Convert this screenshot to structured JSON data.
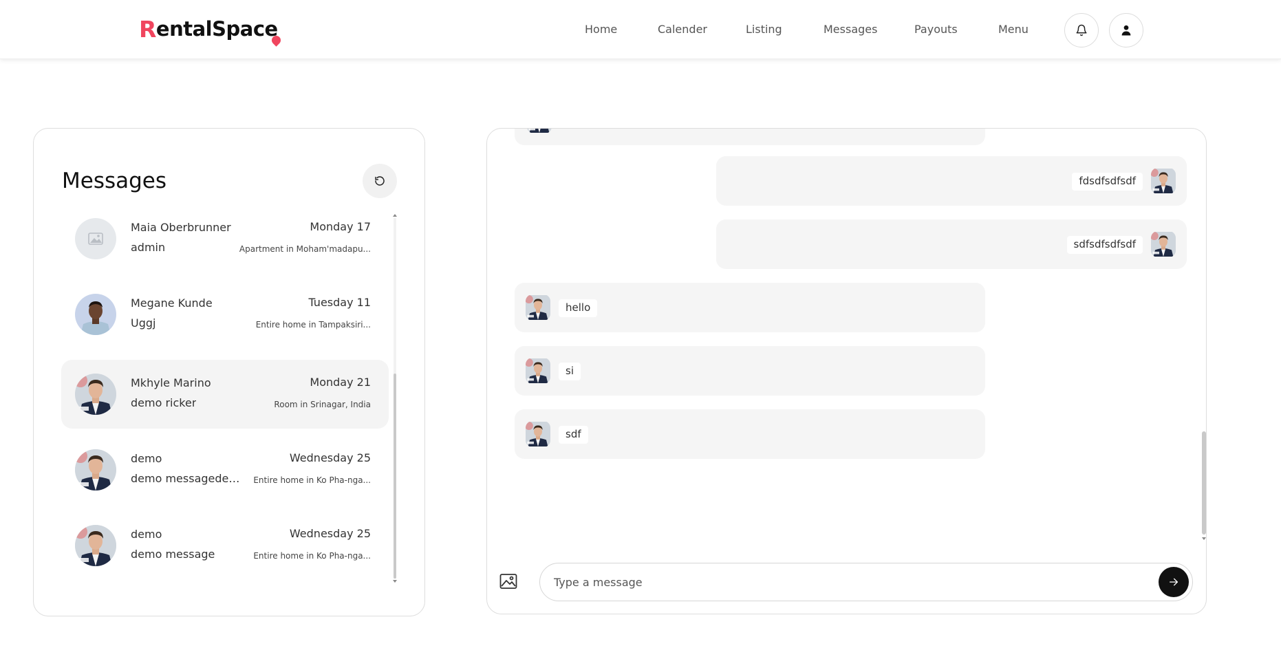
{
  "header": {
    "logo_r": "R",
    "logo_rest": "entalSpace",
    "nav": [
      "Home",
      "Calender",
      "Listing",
      "Messages",
      "Payouts",
      "Menu"
    ],
    "notification_icon": "bell-icon",
    "profile_icon": "user-icon"
  },
  "sidebar": {
    "title": "Messages",
    "refresh_icon": "refresh-icon",
    "conversations": [
      {
        "name": "Maia Oberbrunner",
        "preview": "admin",
        "date": "Monday 17",
        "listing": "Apartment in Moham'madapu...",
        "avatar": "placeholder"
      },
      {
        "name": "Megane Kunde",
        "preview": "Uggj",
        "date": "Tuesday 11",
        "listing": "Entire home in Tampaksiri...",
        "avatar": "man-blue"
      },
      {
        "name": "Mkhyle Marino",
        "preview": "demo ricker",
        "date": "Monday 21",
        "listing": "Room in Srinagar, India",
        "avatar": "man-suit"
      },
      {
        "name": "demo",
        "preview": "demo messagedem...",
        "date": "Wednesday 25",
        "listing": "Entire home in Ko Pha-nga...",
        "avatar": "man-suit"
      },
      {
        "name": "demo",
        "preview": "demo message",
        "date": "Wednesday 25",
        "listing": "Entire home in Ko Pha-nga...",
        "avatar": "man-suit"
      }
    ]
  },
  "chat": {
    "messages": [
      {
        "text": "fdsdfsdfsdf",
        "side": "right"
      },
      {
        "text": "sdfsdfsdfsdf",
        "side": "right"
      },
      {
        "text": "hello",
        "side": "left"
      },
      {
        "text": "si",
        "side": "left"
      },
      {
        "text": "sdf",
        "side": "left"
      }
    ],
    "input_placeholder": "Type a message",
    "image_icon": "image-upload-icon",
    "send_icon": "arrow-right-icon"
  },
  "colors": {
    "brand": "#f0455e",
    "bubble": "#f5f5f5",
    "active_row": "#f4f4f4",
    "send_button": "#111111"
  }
}
